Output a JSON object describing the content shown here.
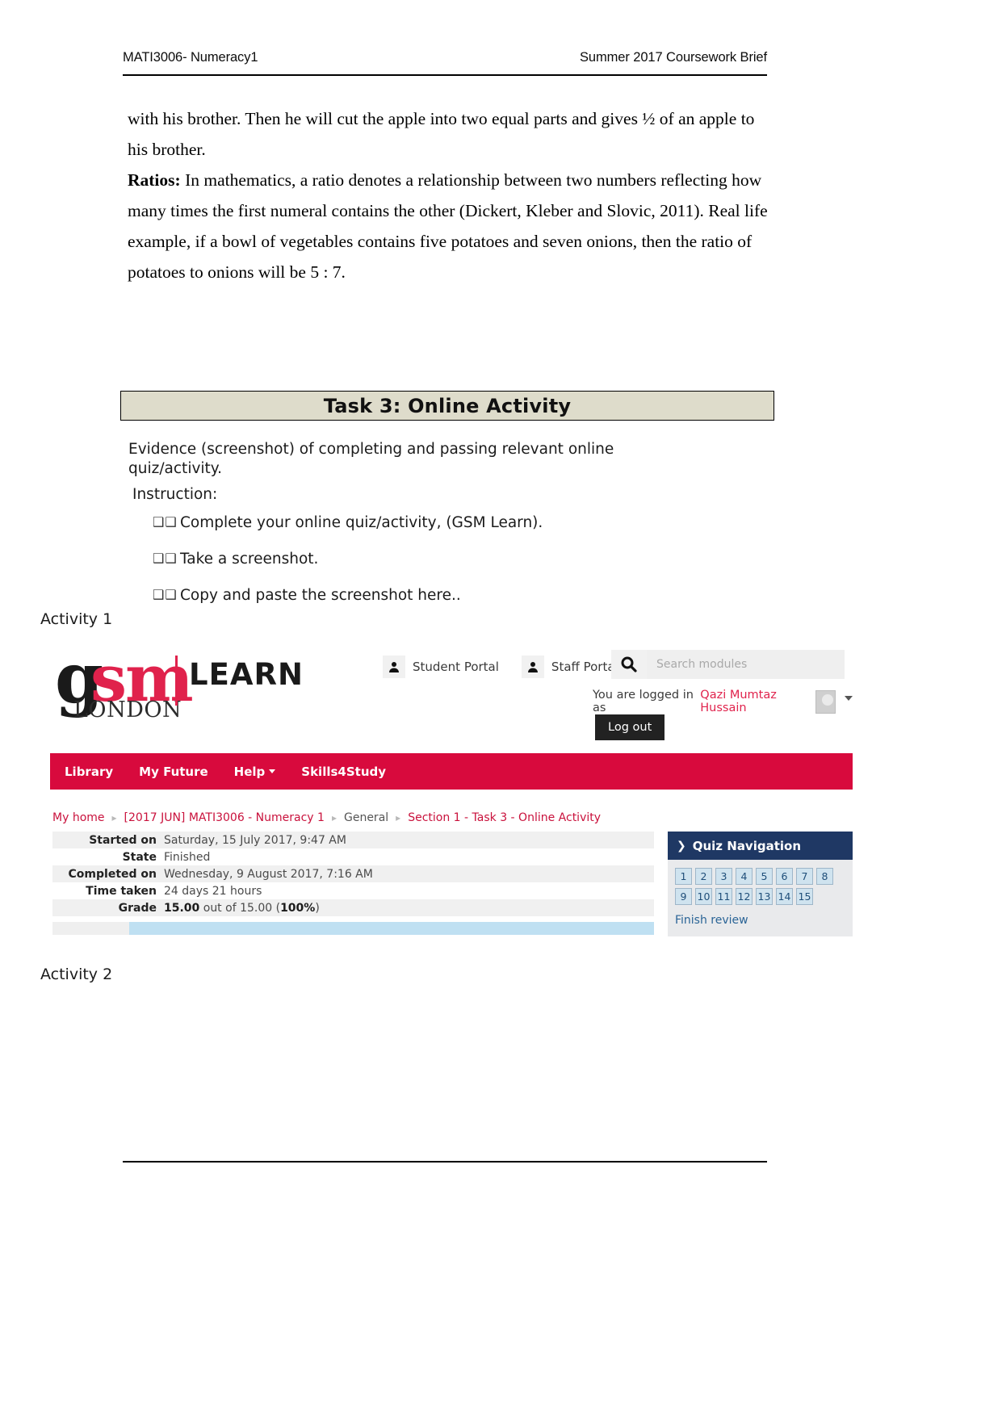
{
  "doc": {
    "header_left": "MATI3006- Numeracy1",
    "header_right": "Summer 2017 Coursework Brief",
    "paragraphs": {
      "p1": "with his brother. Then he will cut the apple into two equal parts and gives ½ of an apple to his brother.",
      "p2_label": "Ratios:",
      "p2_rest": " In mathematics, a ratio denotes a relationship between two numbers reflecting how many times the first numeral contains the other (Dickert, Kleber and Slovic, 2011). Real life example, if a bowl of vegetables contains five potatoes and seven onions, then the ratio of potatoes to onions will be 5 : 7."
    },
    "task_banner": "Task 3:  Online Activity",
    "instructions": {
      "lead": "Evidence (screenshot) of completing and passing relevant online quiz/activity.",
      "label": "Instruction:",
      "bullet_glyph": "❑❑",
      "items": [
        "Complete your online quiz/activity, (GSM Learn).",
        "Take a screenshot.",
        "Copy and paste the screenshot here.."
      ]
    },
    "activity_1_label": "Activity 1",
    "activity_2_label": "Activity 2"
  },
  "screenshot": {
    "logo": {
      "g": "g",
      "sm": "sm",
      "london": "LONDON",
      "learn": "LEARN"
    },
    "portals": [
      {
        "label": "Student Portal",
        "icon": "person-icon"
      },
      {
        "label": "Staff Portal",
        "icon": "person-icon"
      }
    ],
    "search": {
      "icon": "search-icon",
      "placeholder": "Search modules",
      "value": ""
    },
    "session": {
      "logged_in_text": "You are logged in as",
      "user_name": "Qazi Mumtaz Hussain",
      "logout_label": "Log out",
      "avatar": "avatar-icon",
      "caret": "chevron-down-icon"
    },
    "navbar": [
      {
        "label": "Library",
        "has_caret": false
      },
      {
        "label": "My Future",
        "has_caret": false
      },
      {
        "label": "Help",
        "has_caret": true
      },
      {
        "label": "Skills4Study",
        "has_caret": false
      }
    ],
    "breadcrumb": [
      {
        "label": "My home",
        "style": "link"
      },
      {
        "label": "[2017 JUN] MATI3006 - Numeracy 1",
        "style": "link"
      },
      {
        "label": "General",
        "style": "plain"
      },
      {
        "label": "Section 1 - Task 3 - Online Activity",
        "style": "link"
      }
    ],
    "attempt_summary": [
      {
        "key": "Started on",
        "value": "Saturday, 15 July 2017, 9:47 AM",
        "bold_prefix": ""
      },
      {
        "key": "State",
        "value": "Finished",
        "bold_prefix": ""
      },
      {
        "key": "Completed on",
        "value": "Wednesday, 9 August 2017, 7:16 AM",
        "bold_prefix": ""
      },
      {
        "key": "Time taken",
        "value": "24 days 21 hours",
        "bold_prefix": ""
      },
      {
        "key": "Grade",
        "value": " out of 15.00 (",
        "bold_prefix": "15.00",
        "bold_suffix": "100%",
        "value_tail": ")"
      }
    ],
    "quiz_nav": {
      "title": "Quiz Navigation",
      "chevron": "chevron-right-icon",
      "questions": [
        "1",
        "2",
        "3",
        "4",
        "5",
        "6",
        "7",
        "8",
        "9",
        "10",
        "11",
        "12",
        "13",
        "14",
        "15"
      ],
      "finish_review": "Finish review"
    },
    "colors": {
      "brand_red": "#d80a3d",
      "nav_navy": "#1f3864",
      "link_blue": "#2a6496",
      "banner_beige": "#dedccb"
    }
  }
}
